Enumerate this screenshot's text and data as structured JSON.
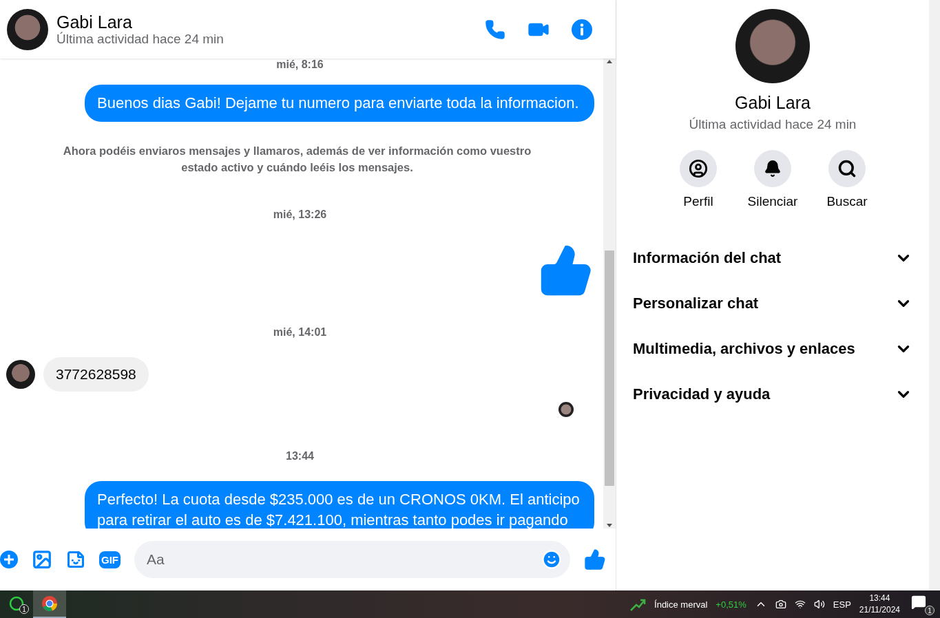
{
  "chat_header": {
    "name": "Gabi Lara",
    "status": "Última actividad hace 24 min"
  },
  "messages": [
    {
      "kind": "timestamp",
      "text": "mié, 8:16"
    },
    {
      "kind": "outgoing",
      "text": "Buenos dias Gabi! Dejame tu numero para enviarte toda la informacion."
    },
    {
      "kind": "notice",
      "text": "Ahora podéis enviaros mensajes y llamaros, además de ver información como vuestro estado activo y cuándo leéis los mensajes."
    },
    {
      "kind": "timestamp",
      "text": "mié, 13:26"
    },
    {
      "kind": "like"
    },
    {
      "kind": "timestamp",
      "text": "mié, 14:01"
    },
    {
      "kind": "incoming",
      "text": "3772628598"
    },
    {
      "kind": "seen"
    },
    {
      "kind": "timestamp",
      "text": "13:44"
    },
    {
      "kind": "outgoing",
      "text": "Perfecto! La cuota desde $235.000 es de un CRONOS 0KM. El anticipo para retirar el auto es de $7.421.100, mientras tanto podes ir pagando"
    }
  ],
  "composer": {
    "gif_label": "GIF",
    "placeholder": "Aa"
  },
  "profile": {
    "name": "Gabi Lara",
    "status": "Última actividad hace 24 min",
    "actions": [
      {
        "kind": "profile",
        "label": "Perfil"
      },
      {
        "kind": "mute",
        "label": "Silenciar"
      },
      {
        "kind": "search",
        "label": "Buscar"
      }
    ],
    "sections": [
      {
        "label": "Información del chat",
        "expanded": false
      },
      {
        "label": "Personalizar chat",
        "expanded": false
      },
      {
        "label": "Multimedia, archivos y enlaces",
        "expanded": false
      },
      {
        "label": "Privacidad y ayuda",
        "expanded": false
      }
    ]
  },
  "taskbar": {
    "apps": [
      {
        "kind": "whatsapp",
        "badge": "1",
        "selected": false
      },
      {
        "kind": "chrome",
        "selected": true
      }
    ],
    "stock": {
      "name": "Índice merval",
      "change": "+0,51%"
    },
    "language": "ESP",
    "time": "13:44",
    "date": "21/11/2024",
    "notifications": "1"
  }
}
